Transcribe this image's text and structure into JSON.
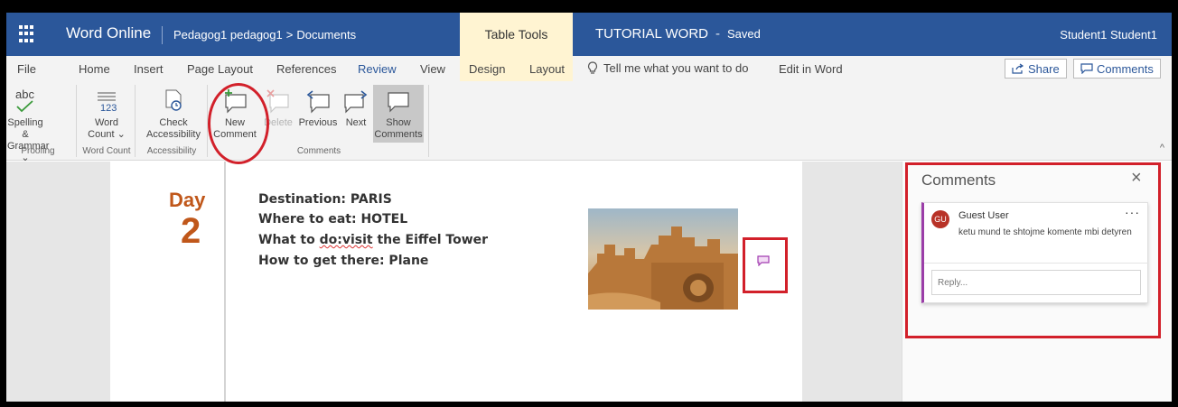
{
  "titlebar": {
    "app_name": "Word Online",
    "breadcrumb_owner": "Pedagog1 pedagog1",
    "breadcrumb_sep": ">",
    "breadcrumb_folder": "Documents",
    "context_tab": "Table Tools",
    "doc_title": "TUTORIAL WORD",
    "doc_sep": "-",
    "save_status": "Saved",
    "user": "Student1 Student1",
    "bg_color": "#2b579a"
  },
  "menu": {
    "tabs": [
      "File",
      "Home",
      "Insert",
      "Page Layout",
      "References",
      "Review",
      "View",
      "Design",
      "Layout"
    ],
    "active_tab": "Review",
    "tell_me": "Tell me what you want to do",
    "edit_in_word": "Edit in Word",
    "share": "Share",
    "comments": "Comments"
  },
  "ribbon": {
    "spelling_l1": "Spelling &",
    "spelling_l2": "Grammar ⌄",
    "word_count_l1": "Word",
    "word_count_l2": "Count ⌄",
    "check_l1": "Check",
    "check_l2": "Accessibility",
    "new_comment_l1": "New",
    "new_comment_l2": "Comment",
    "delete": "Delete",
    "previous": "Previous",
    "next": "Next",
    "show_l1": "Show",
    "show_l2": "Comments",
    "group_proofing": "Proofing",
    "group_word_count": "Word Count",
    "group_accessibility": "Accessibility",
    "group_comments": "Comments",
    "spelling_icon_text": "abc",
    "word_count_icon_text": "123"
  },
  "document": {
    "day_label": "Day",
    "day_number": "2",
    "line1": "Destination: PARIS",
    "line2": "Where to eat: HOTEL",
    "line3_prefix": "What to ",
    "line3_squiggle": "do:visit",
    "line3_suffix": " the Eiffel Tower",
    "line4": "How to get there: Plane",
    "accent_color": "#c0571a"
  },
  "comments_panel": {
    "title": "Comments",
    "close": "×",
    "author_initials": "GU",
    "author": "Guest User",
    "more": "···",
    "text": "ketu mund te shtojme komente mbi detyren",
    "reply_placeholder": "Reply..."
  }
}
